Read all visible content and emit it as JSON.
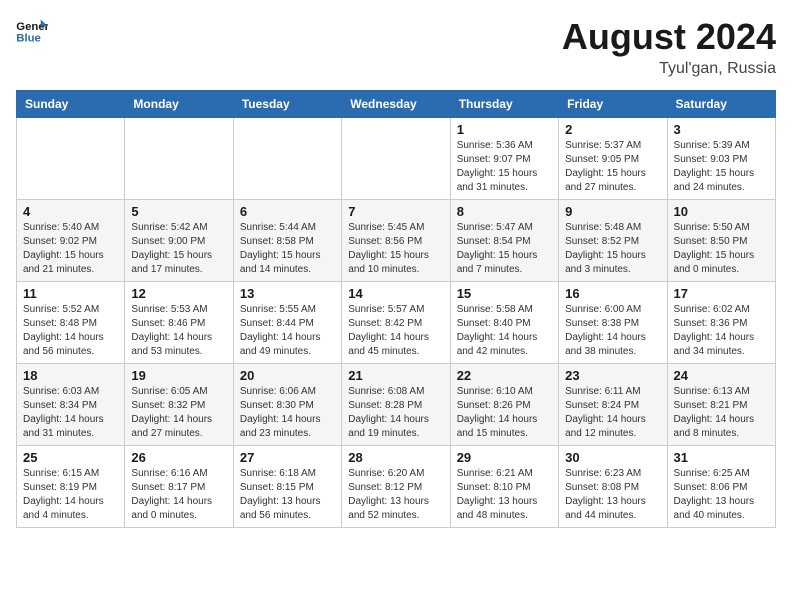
{
  "header": {
    "logo_line1": "General",
    "logo_line2": "Blue",
    "month_year": "August 2024",
    "location": "Tyul'gan, Russia"
  },
  "weekdays": [
    "Sunday",
    "Monday",
    "Tuesday",
    "Wednesday",
    "Thursday",
    "Friday",
    "Saturday"
  ],
  "weeks": [
    [
      {
        "day": "",
        "info": ""
      },
      {
        "day": "",
        "info": ""
      },
      {
        "day": "",
        "info": ""
      },
      {
        "day": "",
        "info": ""
      },
      {
        "day": "1",
        "info": "Sunrise: 5:36 AM\nSunset: 9:07 PM\nDaylight: 15 hours\nand 31 minutes."
      },
      {
        "day": "2",
        "info": "Sunrise: 5:37 AM\nSunset: 9:05 PM\nDaylight: 15 hours\nand 27 minutes."
      },
      {
        "day": "3",
        "info": "Sunrise: 5:39 AM\nSunset: 9:03 PM\nDaylight: 15 hours\nand 24 minutes."
      }
    ],
    [
      {
        "day": "4",
        "info": "Sunrise: 5:40 AM\nSunset: 9:02 PM\nDaylight: 15 hours\nand 21 minutes."
      },
      {
        "day": "5",
        "info": "Sunrise: 5:42 AM\nSunset: 9:00 PM\nDaylight: 15 hours\nand 17 minutes."
      },
      {
        "day": "6",
        "info": "Sunrise: 5:44 AM\nSunset: 8:58 PM\nDaylight: 15 hours\nand 14 minutes."
      },
      {
        "day": "7",
        "info": "Sunrise: 5:45 AM\nSunset: 8:56 PM\nDaylight: 15 hours\nand 10 minutes."
      },
      {
        "day": "8",
        "info": "Sunrise: 5:47 AM\nSunset: 8:54 PM\nDaylight: 15 hours\nand 7 minutes."
      },
      {
        "day": "9",
        "info": "Sunrise: 5:48 AM\nSunset: 8:52 PM\nDaylight: 15 hours\nand 3 minutes."
      },
      {
        "day": "10",
        "info": "Sunrise: 5:50 AM\nSunset: 8:50 PM\nDaylight: 15 hours\nand 0 minutes."
      }
    ],
    [
      {
        "day": "11",
        "info": "Sunrise: 5:52 AM\nSunset: 8:48 PM\nDaylight: 14 hours\nand 56 minutes."
      },
      {
        "day": "12",
        "info": "Sunrise: 5:53 AM\nSunset: 8:46 PM\nDaylight: 14 hours\nand 53 minutes."
      },
      {
        "day": "13",
        "info": "Sunrise: 5:55 AM\nSunset: 8:44 PM\nDaylight: 14 hours\nand 49 minutes."
      },
      {
        "day": "14",
        "info": "Sunrise: 5:57 AM\nSunset: 8:42 PM\nDaylight: 14 hours\nand 45 minutes."
      },
      {
        "day": "15",
        "info": "Sunrise: 5:58 AM\nSunset: 8:40 PM\nDaylight: 14 hours\nand 42 minutes."
      },
      {
        "day": "16",
        "info": "Sunrise: 6:00 AM\nSunset: 8:38 PM\nDaylight: 14 hours\nand 38 minutes."
      },
      {
        "day": "17",
        "info": "Sunrise: 6:02 AM\nSunset: 8:36 PM\nDaylight: 14 hours\nand 34 minutes."
      }
    ],
    [
      {
        "day": "18",
        "info": "Sunrise: 6:03 AM\nSunset: 8:34 PM\nDaylight: 14 hours\nand 31 minutes."
      },
      {
        "day": "19",
        "info": "Sunrise: 6:05 AM\nSunset: 8:32 PM\nDaylight: 14 hours\nand 27 minutes."
      },
      {
        "day": "20",
        "info": "Sunrise: 6:06 AM\nSunset: 8:30 PM\nDaylight: 14 hours\nand 23 minutes."
      },
      {
        "day": "21",
        "info": "Sunrise: 6:08 AM\nSunset: 8:28 PM\nDaylight: 14 hours\nand 19 minutes."
      },
      {
        "day": "22",
        "info": "Sunrise: 6:10 AM\nSunset: 8:26 PM\nDaylight: 14 hours\nand 15 minutes."
      },
      {
        "day": "23",
        "info": "Sunrise: 6:11 AM\nSunset: 8:24 PM\nDaylight: 14 hours\nand 12 minutes."
      },
      {
        "day": "24",
        "info": "Sunrise: 6:13 AM\nSunset: 8:21 PM\nDaylight: 14 hours\nand 8 minutes."
      }
    ],
    [
      {
        "day": "25",
        "info": "Sunrise: 6:15 AM\nSunset: 8:19 PM\nDaylight: 14 hours\nand 4 minutes."
      },
      {
        "day": "26",
        "info": "Sunrise: 6:16 AM\nSunset: 8:17 PM\nDaylight: 14 hours\nand 0 minutes."
      },
      {
        "day": "27",
        "info": "Sunrise: 6:18 AM\nSunset: 8:15 PM\nDaylight: 13 hours\nand 56 minutes."
      },
      {
        "day": "28",
        "info": "Sunrise: 6:20 AM\nSunset: 8:12 PM\nDaylight: 13 hours\nand 52 minutes."
      },
      {
        "day": "29",
        "info": "Sunrise: 6:21 AM\nSunset: 8:10 PM\nDaylight: 13 hours\nand 48 minutes."
      },
      {
        "day": "30",
        "info": "Sunrise: 6:23 AM\nSunset: 8:08 PM\nDaylight: 13 hours\nand 44 minutes."
      },
      {
        "day": "31",
        "info": "Sunrise: 6:25 AM\nSunset: 8:06 PM\nDaylight: 13 hours\nand 40 minutes."
      }
    ]
  ]
}
